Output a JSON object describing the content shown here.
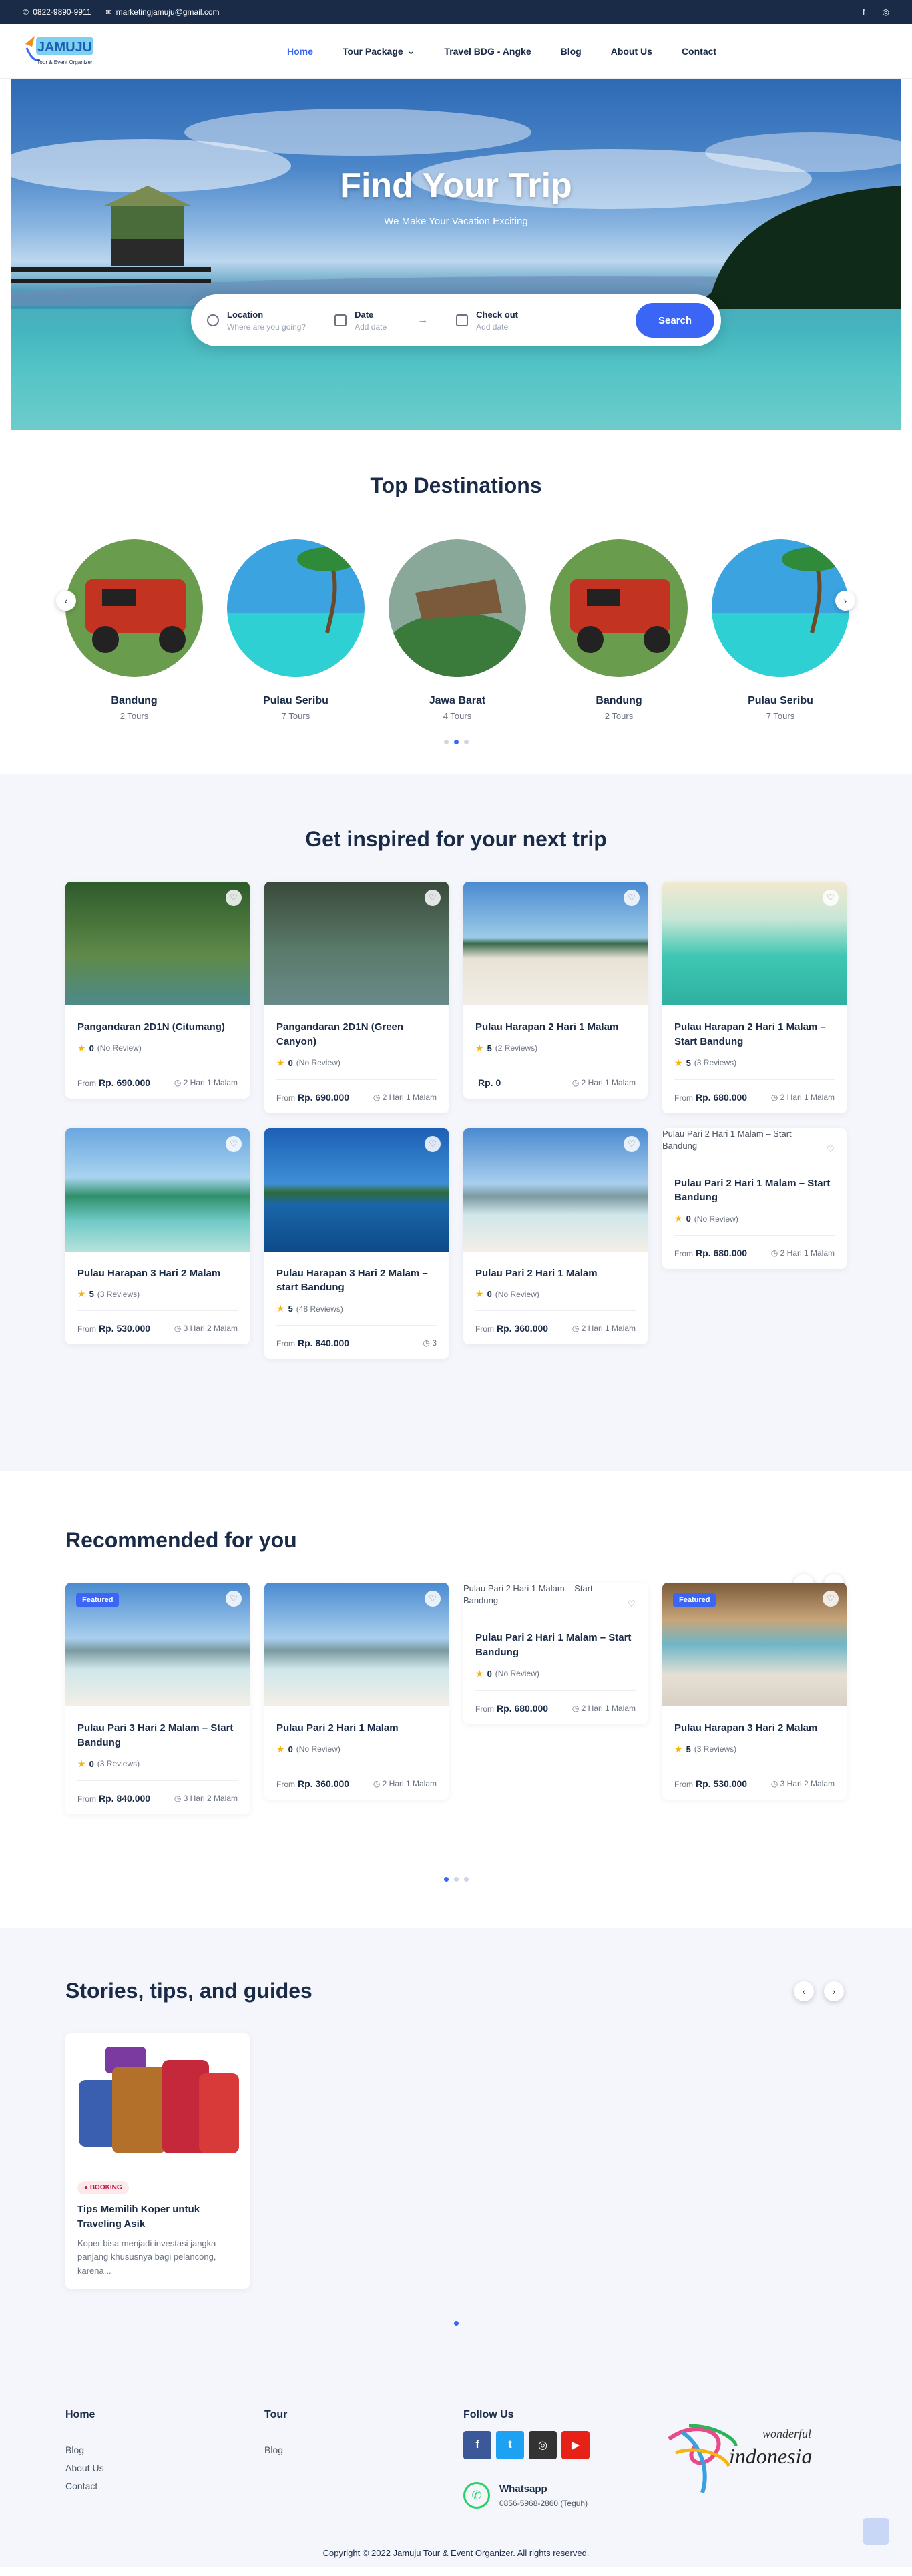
{
  "topbar": {
    "phone": "0822-9890-9911",
    "email": "marketingjamuju@gmail.com",
    "facebook": "f",
    "instagram": "◎"
  },
  "brand": {
    "logo_text": "JAMUJU",
    "logo_tagline": "Tour & Event Organizer"
  },
  "nav": {
    "items": [
      {
        "label": "Home",
        "active": true
      },
      {
        "label": "Tour Package",
        "caret": "⌄"
      },
      {
        "label": "Travel BDG - Angke"
      },
      {
        "label": "Blog"
      },
      {
        "label": "About Us"
      },
      {
        "label": "Contact"
      }
    ]
  },
  "hero": {
    "title": "Find Your Trip",
    "subtitle": "We Make Your Vacation Exciting",
    "search": {
      "location_label": "Location",
      "location_placeholder": "Where are you going?",
      "date_label": "Date",
      "date_placeholder": "Add date",
      "arrow": "→",
      "checkout_label": "Check out",
      "checkout_placeholder": "Add date",
      "button": "Search"
    }
  },
  "destinations": {
    "title": "Top Destinations",
    "items": [
      {
        "name": "Bandung",
        "count": "2 Tours"
      },
      {
        "name": "Pulau Seribu",
        "count": "7 Tours"
      },
      {
        "name": "Jawa Barat",
        "count": "4 Tours"
      },
      {
        "name": "Bandung",
        "count": "2 Tours"
      },
      {
        "name": "Pulau Seribu",
        "count": "7 Tours"
      }
    ],
    "prev": "‹",
    "next": "›"
  },
  "inspire": {
    "title": "Get inspired for your next trip",
    "cards": [
      {
        "title": "Pangandaran 2D1N (Citumang)",
        "rating": "0",
        "reviews": "(No Review)",
        "from": "From",
        "price": "Rp. 690.000",
        "duration": "2 Hari 1 Malam"
      },
      {
        "title": "Pangandaran 2D1N (Green Canyon)",
        "rating": "0",
        "reviews": "(No Review)",
        "from": "From",
        "price": "Rp. 690.000",
        "duration": "2 Hari 1 Malam"
      },
      {
        "title": "Pulau Harapan 2 Hari 1 Malam",
        "rating": "5",
        "reviews": "(2 Reviews)",
        "from": "",
        "price": "Rp. 0",
        "duration": "2 Hari 1 Malam"
      },
      {
        "title": "Pulau Harapan 2 Hari 1 Malam – Start Bandung",
        "rating": "5",
        "reviews": "(3 Reviews)",
        "from": "From",
        "price": "Rp. 680.000",
        "duration": "2 Hari 1 Malam"
      },
      {
        "title": "Pulau Harapan 3 Hari 2 Malam",
        "rating": "5",
        "reviews": "(3 Reviews)",
        "from": "From",
        "price": "Rp. 530.000",
        "duration": "3 Hari 2 Malam"
      },
      {
        "title": "Pulau Harapan 3 Hari 2 Malam – start Bandung",
        "rating": "5",
        "reviews": "(48 Reviews)",
        "from": "From",
        "price": "Rp. 840.000",
        "duration": "3"
      },
      {
        "title": "Pulau Pari 2 Hari 1 Malam",
        "rating": "0",
        "reviews": "(No Review)",
        "from": "From",
        "price": "Rp. 360.000",
        "duration": "2 Hari 1 Malam"
      },
      {
        "title": "Pulau Pari 2 Hari 1 Malam – Start Bandung",
        "alt": "Pulau Pari 2 Hari 1 Malam – Start Bandung",
        "rating": "0",
        "reviews": "(No Review)",
        "from": "From",
        "price": "Rp. 680.000",
        "duration": "2 Hari 1 Malam"
      }
    ]
  },
  "recommended": {
    "title": "Recommended for you",
    "prev": "‹",
    "next": "›",
    "cards": [
      {
        "badge": "Featured",
        "title": "Pulau Pari 3 Hari 2 Malam – Start Bandung",
        "rating": "0",
        "reviews": "(3 Reviews)",
        "from": "From",
        "price": "Rp. 840.000",
        "duration": "3 Hari 2 Malam"
      },
      {
        "title": "Pulau Pari 2 Hari 1 Malam",
        "rating": "0",
        "reviews": "(No Review)",
        "from": "From",
        "price": "Rp. 360.000",
        "duration": "2 Hari 1 Malam"
      },
      {
        "alt": "Pulau Pari 2 Hari 1 Malam – Start Bandung",
        "title": "Pulau Pari 2 Hari 1 Malam – Start Bandung",
        "rating": "0",
        "reviews": "(No Review)",
        "from": "From",
        "price": "Rp. 680.000",
        "duration": "2 Hari 1 Malam"
      },
      {
        "badge": "Featured",
        "title": "Pulau Harapan 3 Hari 2 Malam",
        "rating": "5",
        "reviews": "(3 Reviews)",
        "from": "From",
        "price": "Rp. 530.000",
        "duration": "3 Hari 2 Malam"
      }
    ]
  },
  "stories": {
    "title": "Stories, tips, and guides",
    "prev": "‹",
    "next": "›",
    "post": {
      "category": "BOOKING",
      "title": "Tips Memilih Koper untuk Traveling Asik",
      "excerpt": "Koper bisa menjadi investasi jangka panjang khususnya bagi pelancong, karena..."
    }
  },
  "footer": {
    "home_title": "Home",
    "home_links": [
      "Blog",
      "About Us",
      "Contact"
    ],
    "tour_title": "Tour",
    "tour_links": [
      "Blog"
    ],
    "follow_title": "Follow Us",
    "whatsapp_title": "Whatsapp",
    "whatsapp_number": "0856-5968-2860 (Teguh)",
    "wonderful_top": "wonderful",
    "wonderful_bottom": "indonesia",
    "copyright": "Copyright © 2022 Jamuju Tour & Event Organizer. All rights reserved."
  },
  "colors": {
    "primary": "#3b66f5",
    "navy": "#1a2b48",
    "section_bg": "#f4f6fb",
    "star": "#f5b50a"
  }
}
